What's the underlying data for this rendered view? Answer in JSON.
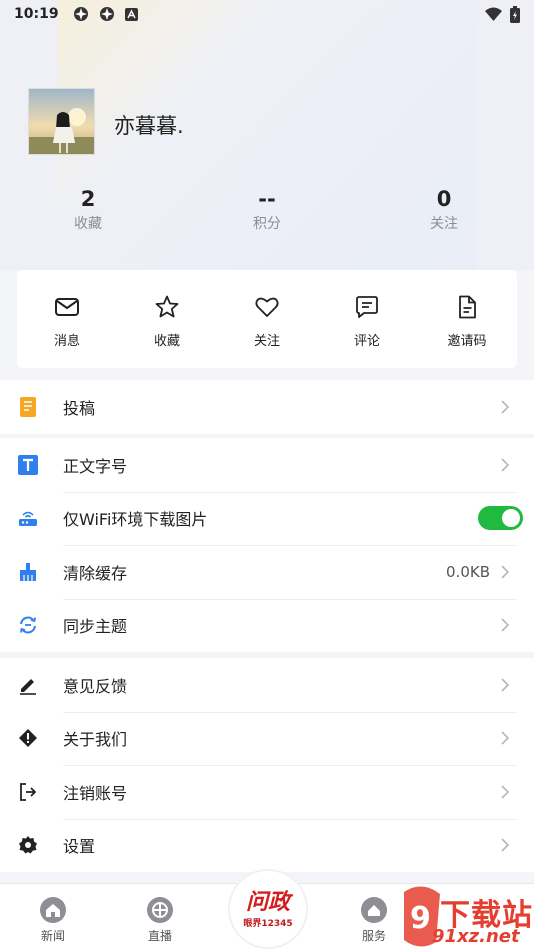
{
  "status_bar": {
    "time": "10:19"
  },
  "profile": {
    "username": "亦暮暮."
  },
  "stats": [
    {
      "value": "2",
      "label": "收藏"
    },
    {
      "value": "--",
      "label": "积分"
    },
    {
      "value": "0",
      "label": "关注"
    }
  ],
  "quick_actions": [
    {
      "label": "消息",
      "icon": "mail-icon"
    },
    {
      "label": "收藏",
      "icon": "star-icon"
    },
    {
      "label": "关注",
      "icon": "heart-icon"
    },
    {
      "label": "评论",
      "icon": "comment-icon"
    },
    {
      "label": "邀请码",
      "icon": "document-icon"
    }
  ],
  "menu": {
    "submit": {
      "label": "投稿"
    },
    "font_size": {
      "label": "正文字号"
    },
    "wifi_only": {
      "label": "仅WiFi环境下载图片",
      "enabled": true
    },
    "clear_cache": {
      "label": "清除缓存",
      "value": "0.0KB"
    },
    "sync_theme": {
      "label": "同步主题"
    },
    "feedback": {
      "label": "意见反馈"
    },
    "about": {
      "label": "关于我们"
    },
    "logout": {
      "label": "注销账号"
    },
    "settings": {
      "label": "设置"
    }
  },
  "tabbar": {
    "news": "新闻",
    "live": "直播",
    "center_title": "问政",
    "center_sub": "眼界12345",
    "service": "服务"
  },
  "watermark": {
    "line1": "下载站",
    "line2": "91xz.net"
  },
  "colors": {
    "toggle_on": "#1fba3f",
    "accent_orange": "#f5a623",
    "accent_blue": "#2f80ed",
    "brand_red": "#d41e1e"
  }
}
